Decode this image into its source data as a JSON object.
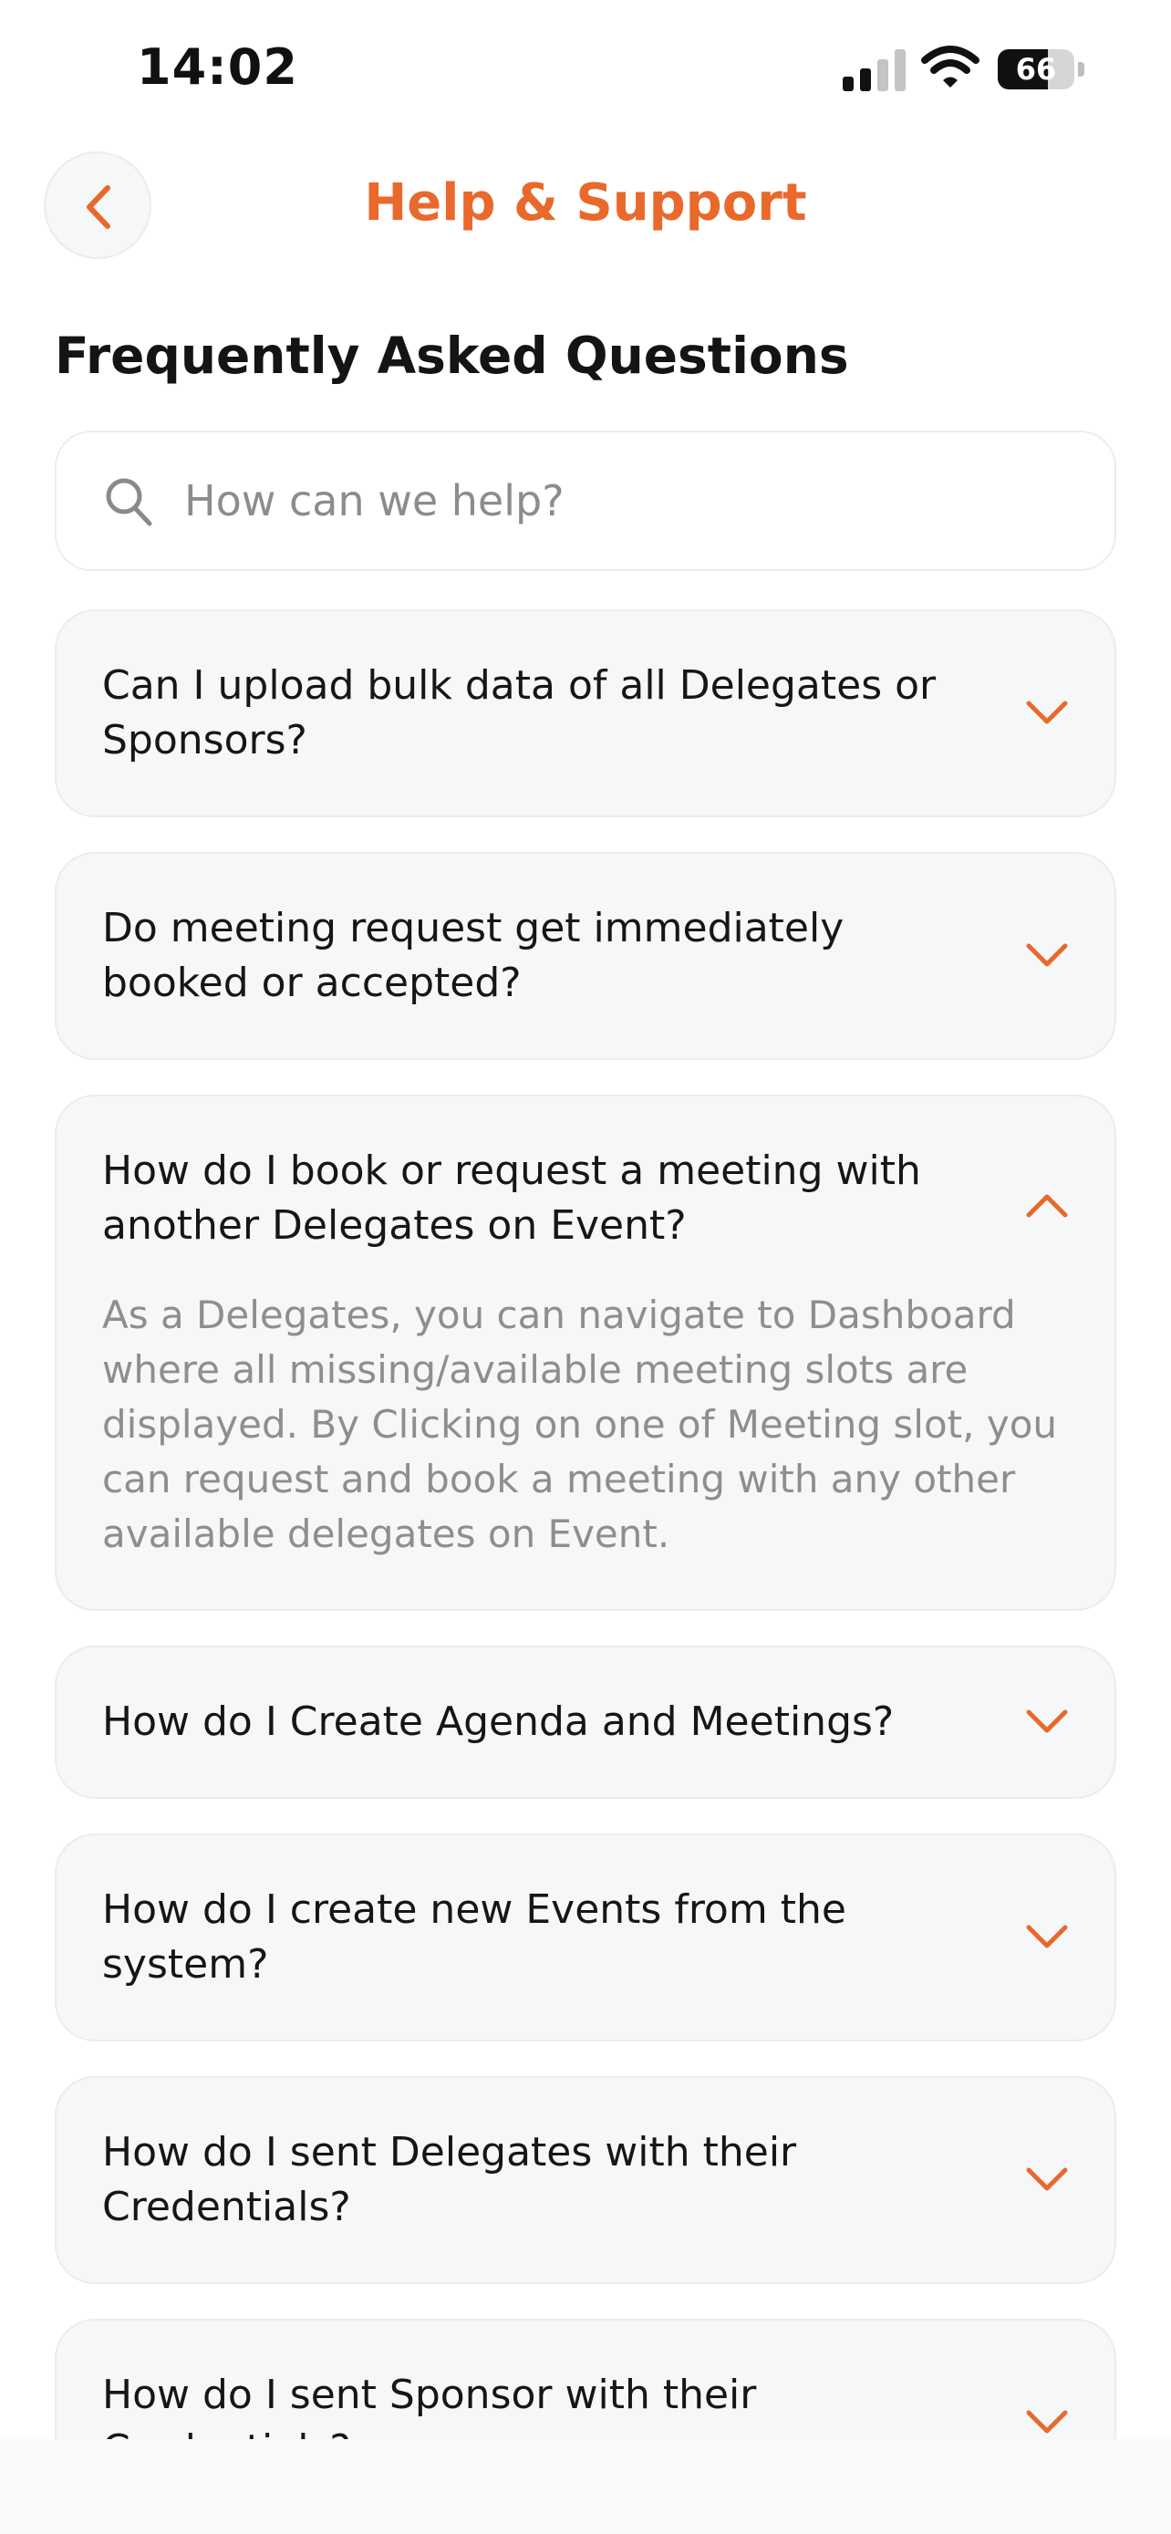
{
  "status_bar": {
    "time": "14:02",
    "battery_level": "66",
    "battery_fraction": 0.66
  },
  "header": {
    "title": "Help & Support",
    "back_icon": "chevron-left-icon"
  },
  "faq": {
    "section_title": "Frequently Asked Questions",
    "search": {
      "placeholder": "How can we help?",
      "value": "",
      "icon": "search-icon"
    },
    "items": [
      {
        "question": "Can I upload bulk data of all Delegates or Sponsors?",
        "expanded": false,
        "answer": ""
      },
      {
        "question": "Do meeting request get immediately booked or accepted?",
        "expanded": false,
        "answer": ""
      },
      {
        "question": "How do I  book or request a meeting with another Delegates on Event?",
        "expanded": true,
        "answer": "As a Delegates, you can navigate to Dashboard where all missing/available meeting slots are displayed. By Clicking on one of Meeting slot, you can request and book a meeting with any other available delegates on Event."
      },
      {
        "question": "How do I Create Agenda and Meetings?",
        "expanded": false,
        "answer": ""
      },
      {
        "question": "How do I create new Events from the system?",
        "expanded": false,
        "answer": ""
      },
      {
        "question": "How do I sent Delegates with their Credentials?",
        "expanded": false,
        "answer": ""
      },
      {
        "question": "How do I sent Sponsor with their Credentials?",
        "expanded": false,
        "answer": ""
      }
    ]
  },
  "colors": {
    "accent": "#e8692b",
    "card_background": "#f6f7f9",
    "text_primary": "#161616",
    "text_muted": "#8e8e8e"
  }
}
